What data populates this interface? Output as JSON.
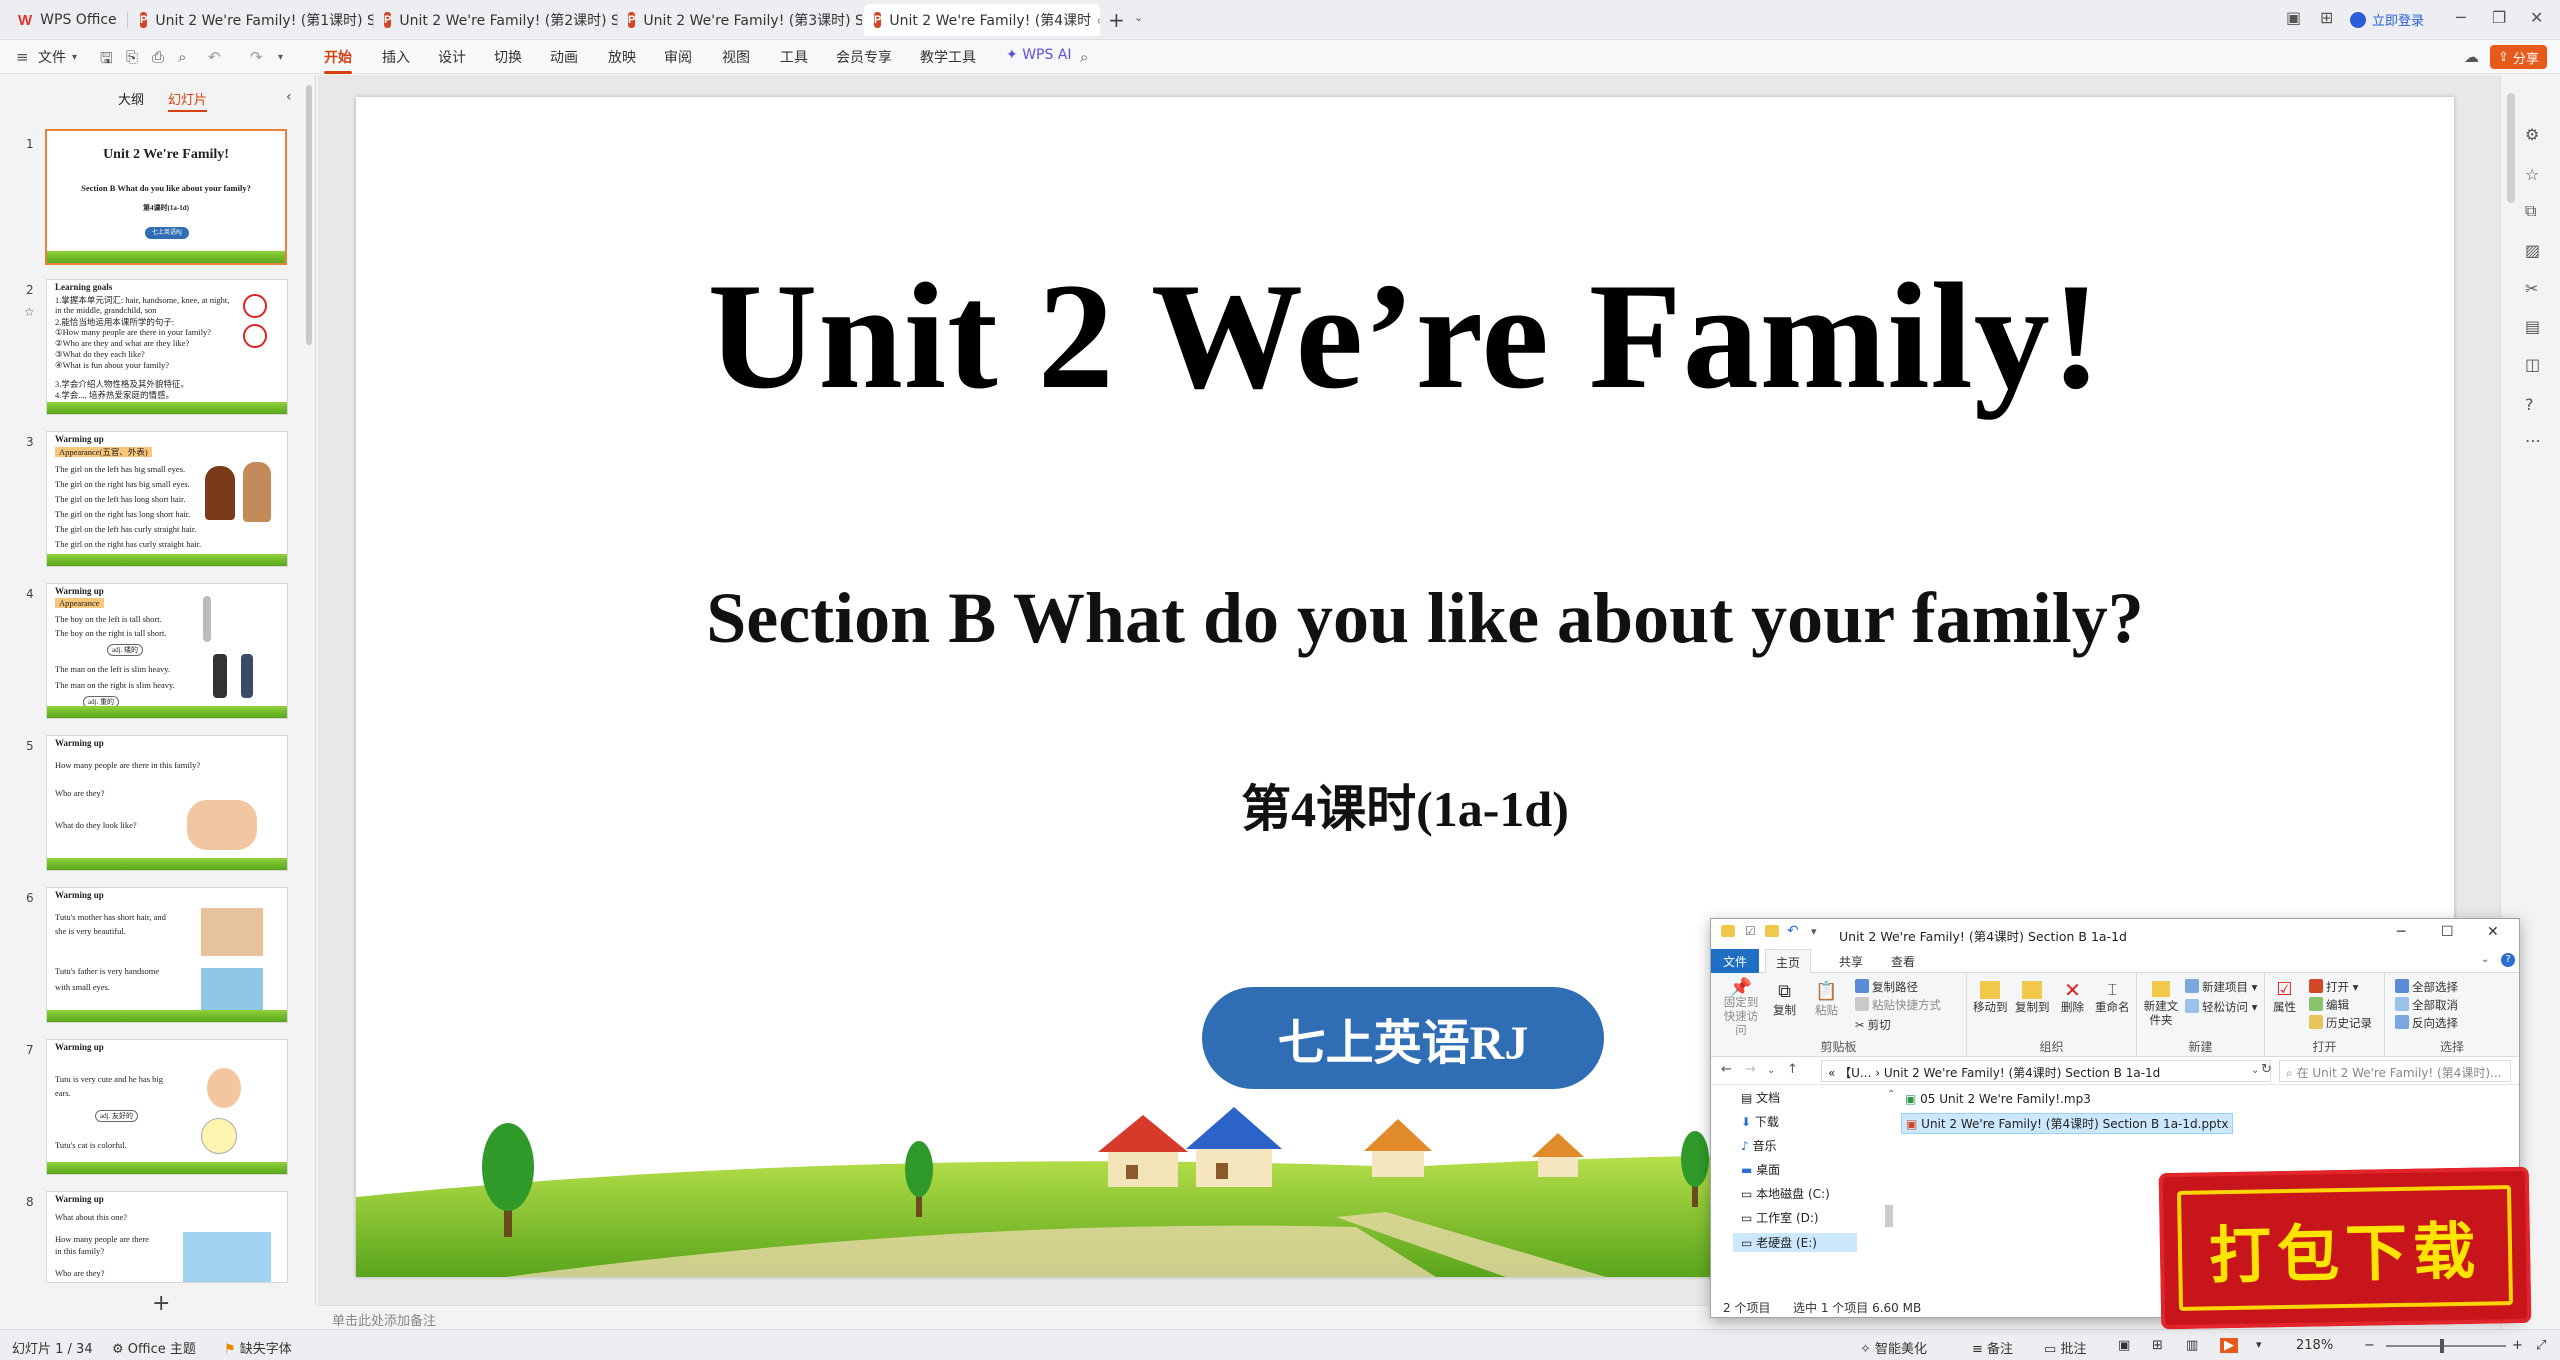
{
  "tabs": [
    {
      "label": "WPS Office",
      "kind": "home"
    },
    {
      "label": "Unit 2 We're Family! (第1课时) Sect",
      "kind": "ppt"
    },
    {
      "label": "Unit 2 We're Family! (第2课时) Sect",
      "kind": "ppt"
    },
    {
      "label": "Unit 2 We're Family! (第3课时) Sect",
      "kind": "ppt"
    },
    {
      "label": "Unit 2 We're Family! (第4课时",
      "kind": "ppt",
      "active": true
    }
  ],
  "login_label": "立即登录",
  "ribbon": {
    "file_menu": "文件",
    "tabs": [
      "开始",
      "插入",
      "设计",
      "切换",
      "动画",
      "放映",
      "审阅",
      "视图",
      "工具",
      "会员专享",
      "教学工具"
    ],
    "active_tab": "开始",
    "wps_ai": "WPS AI",
    "share_label": "分享"
  },
  "panel": {
    "tab_outline": "大纲",
    "tab_slides": "幻灯片"
  },
  "thumbnails": [
    {
      "num": "1",
      "title": "Unit 2 We're Family!",
      "lines": [
        "Section B What do you like about your family?",
        "第4课时(1a-1d)",
        "七上英语RJ"
      ]
    },
    {
      "num": "2",
      "lines": [
        "Learning goals",
        "1.掌握本单元词汇: hair, handsome, knee, at night,",
        "in the middle, grandchild, son",
        "2.能恰当地运用本课所学的句子:",
        "①How many people are there in your family?",
        "②Who are they and what are they like?",
        "③What do they each like?",
        "④What is fun about your family?",
        "3.学会介绍人物性格及其外貌特征。",
        "4.学会..., 培养热爱家庭的情感。"
      ]
    },
    {
      "num": "3",
      "lines": [
        "Warming up",
        "Appearance(五官、外表)",
        "The girl on the left has big small eyes.",
        "The girl on the right has big small eyes.",
        "The girl on the left has long short hair.",
        "The girl on the right has long short hair.",
        "The girl on the left has curly straight hair.",
        "The girl on the right has curly straight hair."
      ]
    },
    {
      "num": "4",
      "lines": [
        "Warming up",
        "Appearance",
        "The boy on the left is tall short.",
        "The boy on the right is tall short.",
        "adj. 矮的",
        "The man on the left is slim heavy.",
        "The man on the right is slim heavy.",
        "adj. 重的"
      ]
    },
    {
      "num": "5",
      "lines": [
        "Warming up",
        "How many people are there in this family?",
        "Who are they?",
        "What do they look like?"
      ]
    },
    {
      "num": "6",
      "lines": [
        "Warming up",
        "Tutu's mother has short hair, and",
        "she is very beautiful.",
        "Tutu's father is very handsome",
        "with small eyes."
      ]
    },
    {
      "num": "7",
      "lines": [
        "Warming up",
        "Tutu is very cute and he has big",
        "ears.",
        "adj. 友好的",
        "Tutu's cat is colorful."
      ]
    },
    {
      "num": "8",
      "lines": [
        "Warming up",
        "What about this one?",
        "How many people are there",
        "in this family?",
        "Who are they?"
      ]
    }
  ],
  "slide": {
    "title": "Unit 2 We’re Family!",
    "subtitle": "Section B What do you like about your family?",
    "lesson": "第4课时(1a-1d)",
    "badge": "七上英语RJ"
  },
  "notes_placeholder": "单击此处添加备注",
  "status": {
    "slide_count": "幻灯片 1 / 34",
    "theme": "Office 主题",
    "missing_font": "缺失字体",
    "smart_beautify": "智能美化",
    "notes": "备注",
    "comments": "批注",
    "zoom": "218%"
  },
  "explorer": {
    "title": "Unit 2 We're Family! (第4课时) Section B 1a-1d",
    "tabs": [
      "文件",
      "主页",
      "共享",
      "查看"
    ],
    "ribbon_groups": [
      {
        "label": "剪贴板",
        "buttons": [
          "固定到快速访问",
          "复制",
          "粘贴",
          "复制路径",
          "粘贴快捷方式",
          "剪切"
        ]
      },
      {
        "label": "组织",
        "buttons": [
          "移动到",
          "复制到",
          "删除",
          "重命名"
        ]
      },
      {
        "label": "新建",
        "buttons": [
          "新建文件夹",
          "新建项目",
          "轻松访问"
        ]
      },
      {
        "label": "打开",
        "buttons": [
          "属性",
          "打开",
          "编辑",
          "历史记录"
        ]
      },
      {
        "label": "选择",
        "buttons": [
          "全部选择",
          "全部取消",
          "反向选择"
        ]
      }
    ],
    "address_prefix": "«  【U...  ›",
    "address": "Unit 2 We're Family! (第4课时) Section B 1a-1d",
    "search_placeholder": "在 Unit 2 We're Family! (第4课时)...",
    "nav": [
      "文档",
      "下载",
      "音乐",
      "桌面",
      "本地磁盘 (C:)",
      "工作室 (D:)",
      "老硬盘 (E:)"
    ],
    "files": [
      {
        "name": "05 Unit 2 We're Family!.mp3",
        "selected": false
      },
      {
        "name": "Unit 2 We're Family! (第4课时) Section B 1a-1d.pptx",
        "selected": true
      }
    ],
    "status_items": "2 个项目",
    "status_selected": "选中 1 个项目  6.60 MB"
  },
  "download_banner": "打包下载",
  "colors": {
    "accent": "#d8400f",
    "badge_blue": "#2f6db4",
    "banner_red": "#c8151b",
    "banner_yellow": "#ffe400"
  }
}
